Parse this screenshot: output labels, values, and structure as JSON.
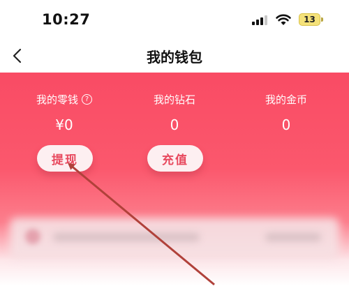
{
  "status_bar": {
    "time": "10:27",
    "battery_level": "13",
    "icons": [
      "signal-icon",
      "wifi-icon",
      "battery-icon"
    ]
  },
  "nav": {
    "title": "我的钱包",
    "back_icon": "chevron-left-icon"
  },
  "wallet": {
    "accent_color": "#f94b64",
    "balances": [
      {
        "label": "我的零钱",
        "value": "¥0",
        "has_help": true,
        "help_icon": "question-circle-icon"
      },
      {
        "label": "我的钻石",
        "value": "0"
      },
      {
        "label": "我的金币",
        "value": "0"
      }
    ],
    "help_glyph": "?",
    "withdraw_label": "提现",
    "recharge_label": "充值"
  },
  "annotation": {
    "type": "arrow",
    "color": "#b0413a",
    "points_to": "withdraw-button"
  }
}
